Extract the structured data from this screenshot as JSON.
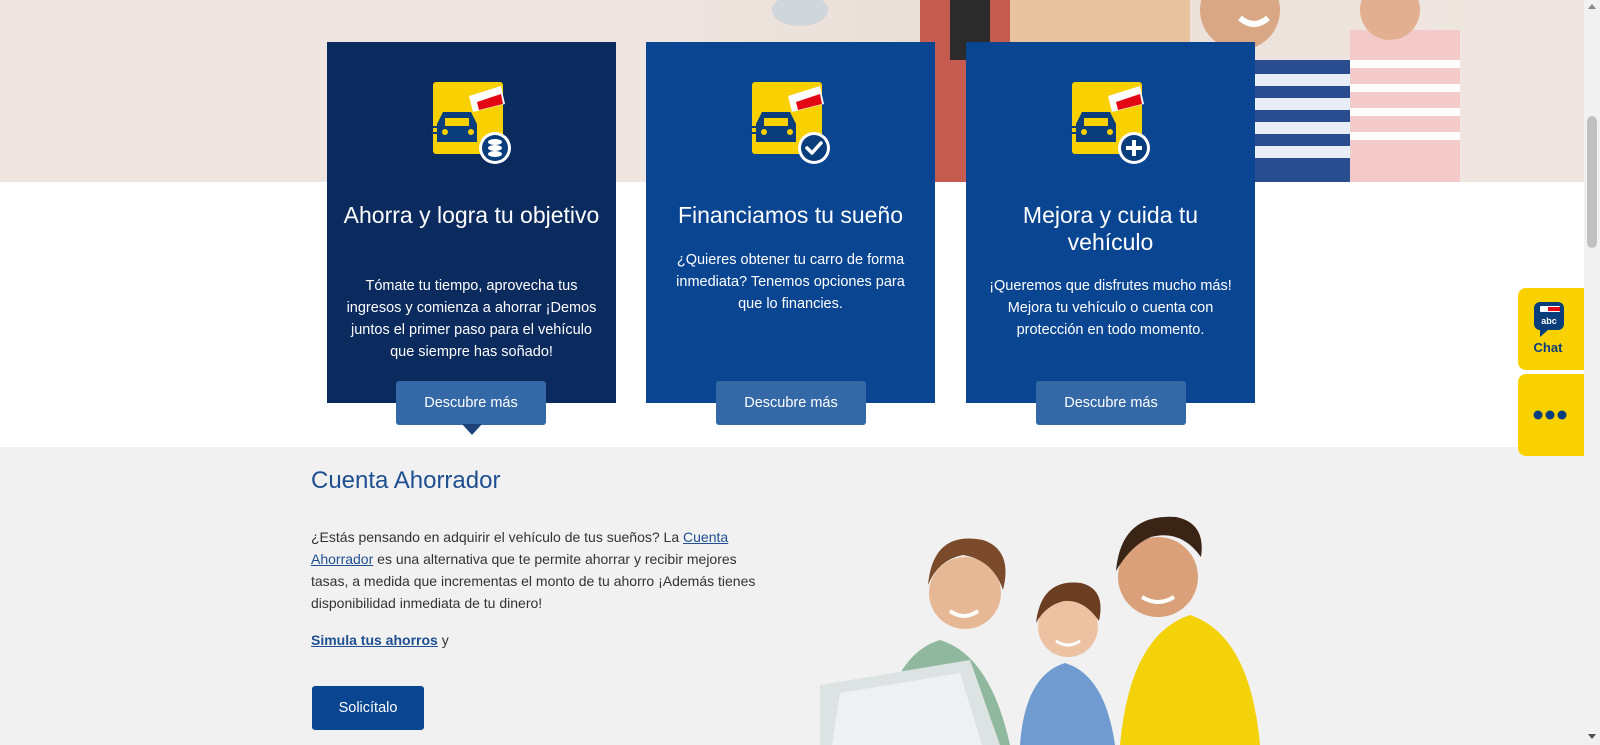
{
  "cards": [
    {
      "title": "Ahorra y logra tu objetivo",
      "text": "Tómate tu tiempo, aprovecha tus ingresos y comienza a ahorrar ¡Demos juntos el primer paso para el vehículo que siempre has soñado!",
      "button": "Descubre más",
      "icon": "car-savings-icon"
    },
    {
      "title": "Financiamos tu sueño",
      "text": "¿Quieres obtener tu carro de forma inmediata? Tenemos opciones para que lo financies.",
      "button": "Descubre más",
      "icon": "car-approved-icon"
    },
    {
      "title": "Mejora y cuida tu vehículo",
      "text": "¡Queremos que disfrutes mucho más! Mejora tu vehículo o cuenta con protección en todo momento.",
      "button": "Descubre más",
      "icon": "car-plus-icon"
    }
  ],
  "section": {
    "title": "Cuenta Ahorrador",
    "body_before": "¿Estás pensando en adquirir el vehículo de tus sueños?  La ",
    "body_link": "Cuenta Ahorrador",
    "body_after": " es una alternativa que te permite ahorrar y recibir mejores tasas, a medida que incrementas el monto de tu ahorro ¡Además tienes disponibilidad inmediata de tu dinero!",
    "simula_link": "Simula tus ahorros",
    "simula_after": " y",
    "cta": "Solicítalo"
  },
  "widgets": {
    "chat_icon_text": "abc",
    "chat_label": "Chat"
  },
  "colors": {
    "card_dark": "#0b2a5e",
    "card_blue": "#0a4592",
    "button_blue": "#3468a6",
    "accent_yellow": "#f9d100",
    "title_blue": "#1d4f91"
  }
}
